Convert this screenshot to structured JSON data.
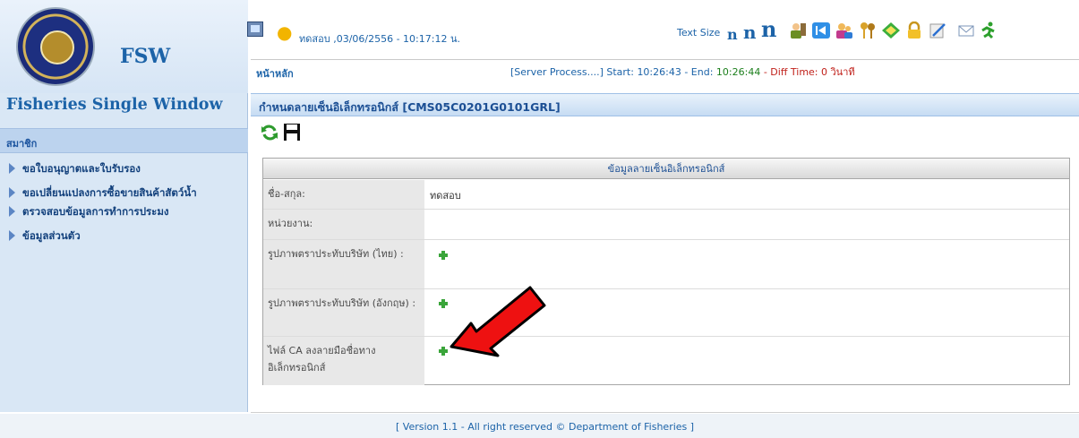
{
  "brand": {
    "short": "FSW",
    "full": "Fisheries Single Window"
  },
  "sidebar": {
    "section_label": "สมาชิก",
    "items": [
      {
        "label": "ขอใบอนุญาตและใบรับรอง"
      },
      {
        "label": "ขอเปลี่ยนแปลงการซื้อขายสินค้าสัตว์น้ำ"
      },
      {
        "label": "ตรวจสอบข้อมูลการทำการประมง"
      },
      {
        "label": "ข้อมูลส่วนตัว"
      }
    ]
  },
  "topbar": {
    "user_info": "ทดสอบ ,03/06/2556 - 10:17:12 น.",
    "text_size_label": "Text Size",
    "text_size_small": "n",
    "text_size_medium": "n",
    "text_size_large": "n"
  },
  "breadcrumb": {
    "home": "หน้าหลัก"
  },
  "server": {
    "prefix": "[Server Process....] Start: ",
    "start": "10:26:43",
    "mid": " - End: ",
    "end": "10:26:44",
    "diff_label": " - Diff Time: 0 วินาที"
  },
  "page": {
    "title": "กำหนดลายเซ็นอิเล็กทรอนิกส์ [CMS05C0201G0101GRL]"
  },
  "form": {
    "header": "ข้อมูลลายเซ็นอิเล็กทรอนิกส์",
    "rows": [
      {
        "label": "ชื่อ-สกุล:",
        "value": "ทดสอบ"
      },
      {
        "label": "หน่วยงาน:",
        "value": ""
      },
      {
        "label": "รูปภาพตราประทับบริษัท (ไทย) :",
        "value": ""
      },
      {
        "label": "รูปภาพตราประทับบริษัท (อังกฤษ) :",
        "value": ""
      },
      {
        "label": "ไฟล์ CA ลงลายมือชื่อทางอิเล็กทรอนิกส์",
        "value": ""
      }
    ]
  },
  "footer": {
    "text": "[ Version 1.1 - All right reserved © Department of Fisheries ]"
  },
  "colors": {
    "brand_blue": "#1c63a8",
    "add_green": "#3aa53a",
    "annotation_red": "#ee1111"
  }
}
